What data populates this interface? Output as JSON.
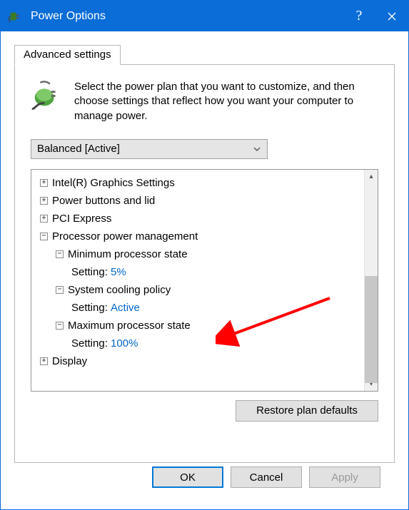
{
  "window": {
    "title": "Power Options"
  },
  "tab": {
    "label": "Advanced settings"
  },
  "intro": "Select the power plan that you want to customize, and then choose settings that reflect how you want your computer to manage power.",
  "plan": {
    "selected": "Balanced [Active]"
  },
  "tree": {
    "intel": "Intel(R) Graphics Settings",
    "powerButtons": "Power buttons and lid",
    "pciExpress": "PCI Express",
    "procPower": "Processor power management",
    "minState": "Minimum processor state",
    "minSettingLabel": "Setting:",
    "minSettingValue": "5%",
    "coolingPolicy": "System cooling policy",
    "coolingLabel": "Setting:",
    "coolingValue": "Active",
    "maxState": "Maximum processor state",
    "maxSettingLabel": "Setting:",
    "maxSettingValue": "100%",
    "display": "Display"
  },
  "buttons": {
    "restore": "Restore plan defaults",
    "ok": "OK",
    "cancel": "Cancel",
    "apply": "Apply"
  }
}
